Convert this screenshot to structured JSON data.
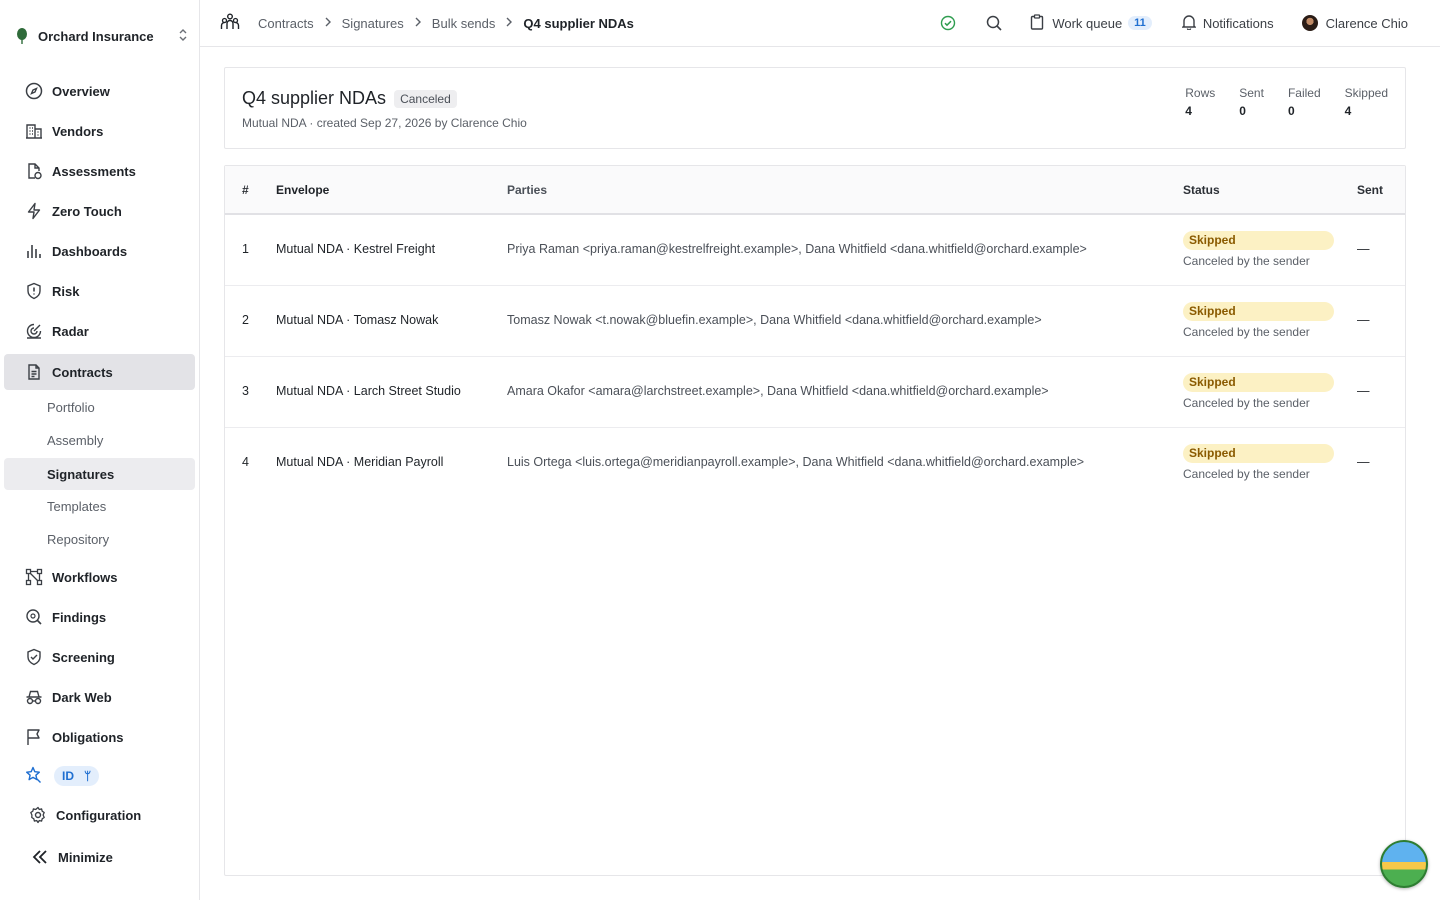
{
  "org": {
    "name": "Orchard Insurance"
  },
  "nav": [
    {
      "key": "overview",
      "label": "Overview",
      "icon": "compass-icon"
    },
    {
      "key": "vendors",
      "label": "Vendors",
      "icon": "buildings-icon"
    },
    {
      "key": "assessments",
      "label": "Assessments",
      "icon": "file-check-icon"
    },
    {
      "key": "zero-touch",
      "label": "Zero Touch",
      "icon": "bolt-icon"
    },
    {
      "key": "dashboards",
      "label": "Dashboards",
      "icon": "bar-chart-icon"
    },
    {
      "key": "risk",
      "label": "Risk",
      "icon": "shield-alert-icon"
    },
    {
      "key": "radar",
      "label": "Radar",
      "icon": "radar-icon"
    },
    {
      "key": "contracts",
      "label": "Contracts",
      "icon": "document-icon"
    }
  ],
  "contracts_sub": [
    "Portfolio",
    "Assembly",
    "Signatures",
    "Templates",
    "Repository"
  ],
  "nav2": [
    {
      "key": "workflows",
      "label": "Workflows",
      "icon": "workflow-icon"
    },
    {
      "key": "findings",
      "label": "Findings",
      "icon": "magnifier-icon"
    },
    {
      "key": "screening",
      "label": "Screening",
      "icon": "shield-check-icon"
    },
    {
      "key": "dark-web",
      "label": "Dark Web",
      "icon": "incognito-icon"
    },
    {
      "key": "obligations",
      "label": "Obligations",
      "icon": "flag-icon"
    }
  ],
  "id_badge": {
    "label": "ID",
    "extra": "ᛘ"
  },
  "configuration": "Configuration",
  "minimize": "Minimize",
  "breadcrumbs": [
    "Contracts",
    "Signatures",
    "Bulk sends",
    "Q4 supplier NDAs"
  ],
  "topbar": {
    "work_queue": "Work queue",
    "work_queue_count": "11",
    "notifications": "Notifications",
    "user": "Clarence Chio"
  },
  "header": {
    "title": "Q4 supplier NDAs",
    "status": "Canceled",
    "subtitle": "Mutual NDA · created Sep 27, 2026 by Clarence Chio",
    "stats": [
      {
        "label": "Rows",
        "value": "4"
      },
      {
        "label": "Sent",
        "value": "0"
      },
      {
        "label": "Failed",
        "value": "0"
      },
      {
        "label": "Skipped",
        "value": "4"
      }
    ]
  },
  "table": {
    "columns": [
      "#",
      "Envelope",
      "Parties",
      "Status",
      "Sent"
    ],
    "rows": [
      {
        "num": "1",
        "envelope": "Mutual NDA · Kestrel Freight",
        "parties": "Priya Raman <priya.raman@kestrelfreight.example>, Dana Whitfield <dana.whitfield@orchard.example>",
        "status": "Skipped",
        "note": "Canceled by the sender",
        "sent": "—"
      },
      {
        "num": "2",
        "envelope": "Mutual NDA · Tomasz Nowak",
        "parties": "Tomasz Nowak <t.nowak@bluefin.example>, Dana Whitfield <dana.whitfield@orchard.example>",
        "status": "Skipped",
        "note": "Canceled by the sender",
        "sent": "—"
      },
      {
        "num": "3",
        "envelope": "Mutual NDA · Larch Street Studio",
        "parties": "Amara Okafor <amara@larchstreet.example>, Dana Whitfield <dana.whitfield@orchard.example>",
        "status": "Skipped",
        "note": "Canceled by the sender",
        "sent": "—"
      },
      {
        "num": "4",
        "envelope": "Mutual NDA · Meridian Payroll",
        "parties": "Luis Ortega <luis.ortega@meridianpayroll.example>, Dana Whitfield <dana.whitfield@orchard.example>",
        "status": "Skipped",
        "note": "Canceled by the sender",
        "sent": "—"
      }
    ]
  },
  "colors": {
    "accent": "#1f6fd1",
    "skipped_bg": "#fcf1c4",
    "skipped_fg": "#8a5a00",
    "ok": "#2e9d4f"
  }
}
